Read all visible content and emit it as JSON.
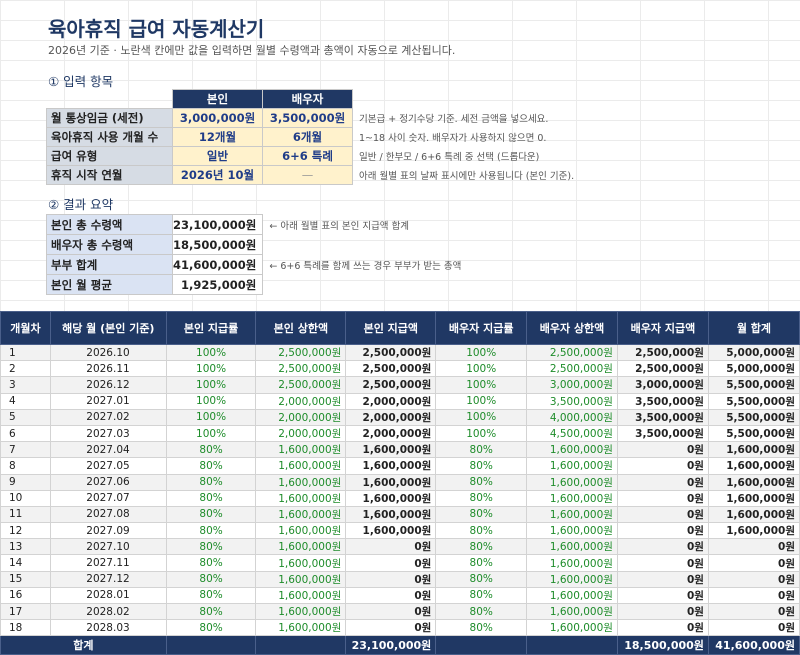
{
  "title": "육아휴직 급여 자동계산기",
  "subtitle": "2026년 기준 · 노란색 칸에만 값을 입력하면 월별 수령액과 총액이 자동으로 계산됩니다.",
  "input_section": {
    "heading": "① 입력 항목",
    "col_self": "본인",
    "col_spouse": "배우자",
    "rows": [
      {
        "label": "월 통상임금 (세전)",
        "self": "3,000,000원",
        "spouse": "3,500,000원",
        "note": "기본급 + 정기수당 기준. 세전 금액을 넣으세요."
      },
      {
        "label": "육아휴직 사용 개월 수",
        "self": "12개월",
        "spouse": "6개월",
        "note": "1~18 사이 숫자. 배우자가 사용하지 않으면 0."
      },
      {
        "label": "급여 유형",
        "self": "일반",
        "spouse": "6+6 특례",
        "note": "일반 / 한부모 / 6+6 특례 중 선택 (드롭다운)"
      },
      {
        "label": "휴직 시작 연월",
        "self": "2026년 10월",
        "spouse": "—",
        "note": "아래 월별 표의 날짜 표시에만 사용됩니다 (본인 기준)."
      }
    ]
  },
  "result_section": {
    "heading": "② 결과 요약",
    "rows": [
      {
        "label": "본인 총 수령액",
        "value": "23,100,000원",
        "note": "← 아래 월별 표의 본인 지급액 합계"
      },
      {
        "label": "배우자 총 수령액",
        "value": "18,500,000원",
        "note": ""
      },
      {
        "label": "부부 합계",
        "value": "41,600,000원",
        "note": "← 6+6 특례를 함께 쓰는 경우 부부가 받는 총액"
      },
      {
        "label": "본인 월 평균",
        "value": "1,925,000원",
        "note": ""
      }
    ]
  },
  "monthly_table": {
    "headers": [
      "개월차",
      "해당 월 (본인 기준)",
      "본인 지급률",
      "본인 상한액",
      "본인 지급액",
      "배우자 지급률",
      "배우자 상한액",
      "배우자 지급액",
      "월 합계"
    ],
    "rows": [
      [
        "1",
        "2026.10",
        "100%",
        "2,500,000원",
        "2,500,000원",
        "100%",
        "2,500,000원",
        "2,500,000원",
        "5,000,000원"
      ],
      [
        "2",
        "2026.11",
        "100%",
        "2,500,000원",
        "2,500,000원",
        "100%",
        "2,500,000원",
        "2,500,000원",
        "5,000,000원"
      ],
      [
        "3",
        "2026.12",
        "100%",
        "2,500,000원",
        "2,500,000원",
        "100%",
        "3,000,000원",
        "3,000,000원",
        "5,500,000원"
      ],
      [
        "4",
        "2027.01",
        "100%",
        "2,000,000원",
        "2,000,000원",
        "100%",
        "3,500,000원",
        "3,500,000원",
        "5,500,000원"
      ],
      [
        "5",
        "2027.02",
        "100%",
        "2,000,000원",
        "2,000,000원",
        "100%",
        "4,000,000원",
        "3,500,000원",
        "5,500,000원"
      ],
      [
        "6",
        "2027.03",
        "100%",
        "2,000,000원",
        "2,000,000원",
        "100%",
        "4,500,000원",
        "3,500,000원",
        "5,500,000원"
      ],
      [
        "7",
        "2027.04",
        "80%",
        "1,600,000원",
        "1,600,000원",
        "80%",
        "1,600,000원",
        "0원",
        "1,600,000원"
      ],
      [
        "8",
        "2027.05",
        "80%",
        "1,600,000원",
        "1,600,000원",
        "80%",
        "1,600,000원",
        "0원",
        "1,600,000원"
      ],
      [
        "9",
        "2027.06",
        "80%",
        "1,600,000원",
        "1,600,000원",
        "80%",
        "1,600,000원",
        "0원",
        "1,600,000원"
      ],
      [
        "10",
        "2027.07",
        "80%",
        "1,600,000원",
        "1,600,000원",
        "80%",
        "1,600,000원",
        "0원",
        "1,600,000원"
      ],
      [
        "11",
        "2027.08",
        "80%",
        "1,600,000원",
        "1,600,000원",
        "80%",
        "1,600,000원",
        "0원",
        "1,600,000원"
      ],
      [
        "12",
        "2027.09",
        "80%",
        "1,600,000원",
        "1,600,000원",
        "80%",
        "1,600,000원",
        "0원",
        "1,600,000원"
      ],
      [
        "13",
        "2027.10",
        "80%",
        "1,600,000원",
        "0원",
        "80%",
        "1,600,000원",
        "0원",
        "0원"
      ],
      [
        "14",
        "2027.11",
        "80%",
        "1,600,000원",
        "0원",
        "80%",
        "1,600,000원",
        "0원",
        "0원"
      ],
      [
        "15",
        "2027.12",
        "80%",
        "1,600,000원",
        "0원",
        "80%",
        "1,600,000원",
        "0원",
        "0원"
      ],
      [
        "16",
        "2028.01",
        "80%",
        "1,600,000원",
        "0원",
        "80%",
        "1,600,000원",
        "0원",
        "0원"
      ],
      [
        "17",
        "2028.02",
        "80%",
        "1,600,000원",
        "0원",
        "80%",
        "1,600,000원",
        "0원",
        "0원"
      ],
      [
        "18",
        "2028.03",
        "80%",
        "1,600,000원",
        "0원",
        "80%",
        "1,600,000원",
        "0원",
        "0원"
      ]
    ],
    "total_label": "합계",
    "total_self": "23,100,000원",
    "total_spouse": "18,500,000원",
    "total_sum": "41,600,000원"
  },
  "colors": {
    "header_navy": "#203864",
    "input_yellow": "#fff2cc",
    "label_gray": "#d6dce4",
    "result_blue": "#dae3f3",
    "rate_green": "#1e8c2a"
  }
}
